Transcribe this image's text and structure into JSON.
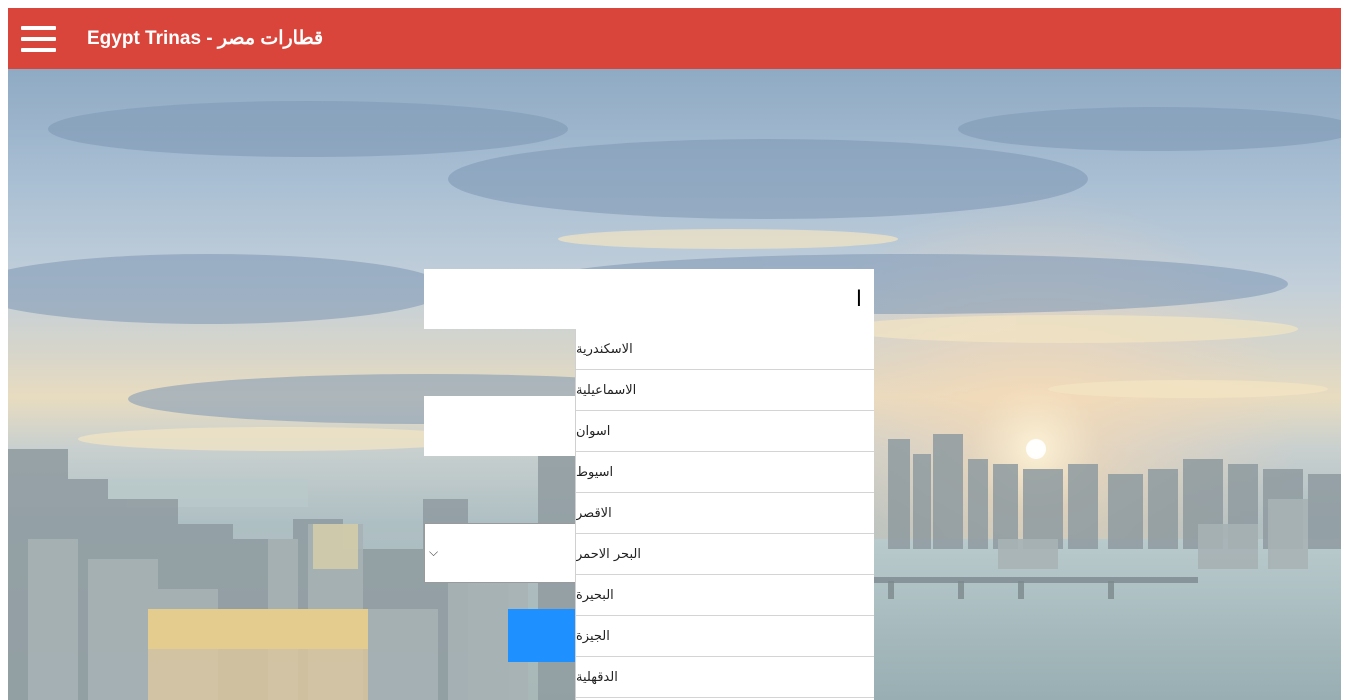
{
  "header": {
    "brand": "Egypt Trinas - قطارات مصر",
    "menu_icon": "hamburger-menu-icon",
    "background_color": "#d9453b"
  },
  "search_form": {
    "from_value": "ا",
    "to_value": "",
    "date_value": "",
    "search_button_color": "#1e90ff"
  },
  "autocomplete": {
    "items": [
      "الاسكندرية",
      "الاسماعيلية",
      "اسوان",
      "اسيوط",
      "الاقصر",
      "البحر الاحمر",
      "البحيرة",
      "الجيزة",
      "الدقهلية"
    ]
  }
}
